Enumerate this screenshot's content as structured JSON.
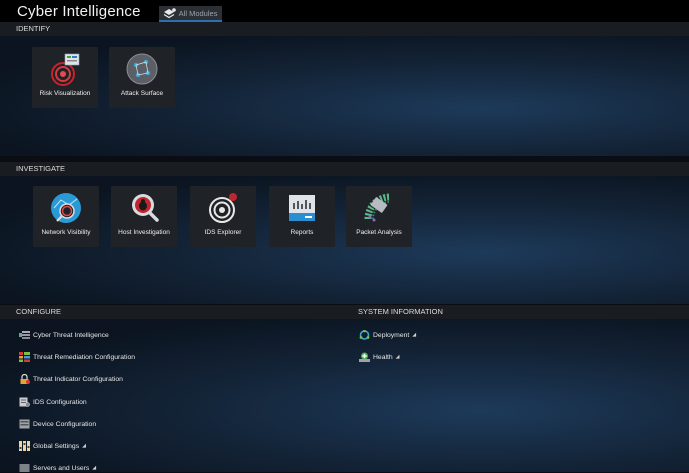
{
  "app": {
    "title": "Cyber Intelligence",
    "modules_tab": "All Modules"
  },
  "identify": {
    "header": "IDENTIFY",
    "tiles": [
      {
        "label": "Risk Visualization",
        "icon": "radar-icon"
      },
      {
        "label": "Attack Surface",
        "icon": "globe-network-icon"
      }
    ]
  },
  "investigate": {
    "header": "INVESTIGATE",
    "tiles": [
      {
        "label": "Network Visibility",
        "icon": "network-search-icon"
      },
      {
        "label": "Host Investigation",
        "icon": "bug-search-icon"
      },
      {
        "label": "IDS Explorer",
        "icon": "target-icon"
      },
      {
        "label": "Reports",
        "icon": "report-icon"
      },
      {
        "label": "Packet Analysis",
        "icon": "packet-icon"
      }
    ]
  },
  "configure": {
    "header": "CONFIGURE",
    "items": [
      {
        "label": "Cyber Threat Intelligence",
        "icon": "threat-intel-icon"
      },
      {
        "label": "Threat Remediation Configuration",
        "icon": "remediation-icon"
      },
      {
        "label": "Threat Indicator Configuration",
        "icon": "lock-icon"
      },
      {
        "label": "IDS Configuration",
        "icon": "ids-config-icon"
      },
      {
        "label": "Device Configuration",
        "icon": "device-icon"
      },
      {
        "label": "Global Settings",
        "icon": "settings-columns-icon"
      },
      {
        "label": "Servers and Users",
        "icon": "servers-icon"
      }
    ]
  },
  "system_information": {
    "header": "SYSTEM INFORMATION",
    "items": [
      {
        "label": "Deployment",
        "icon": "deployment-icon"
      },
      {
        "label": "Health",
        "icon": "health-icon"
      }
    ]
  }
}
